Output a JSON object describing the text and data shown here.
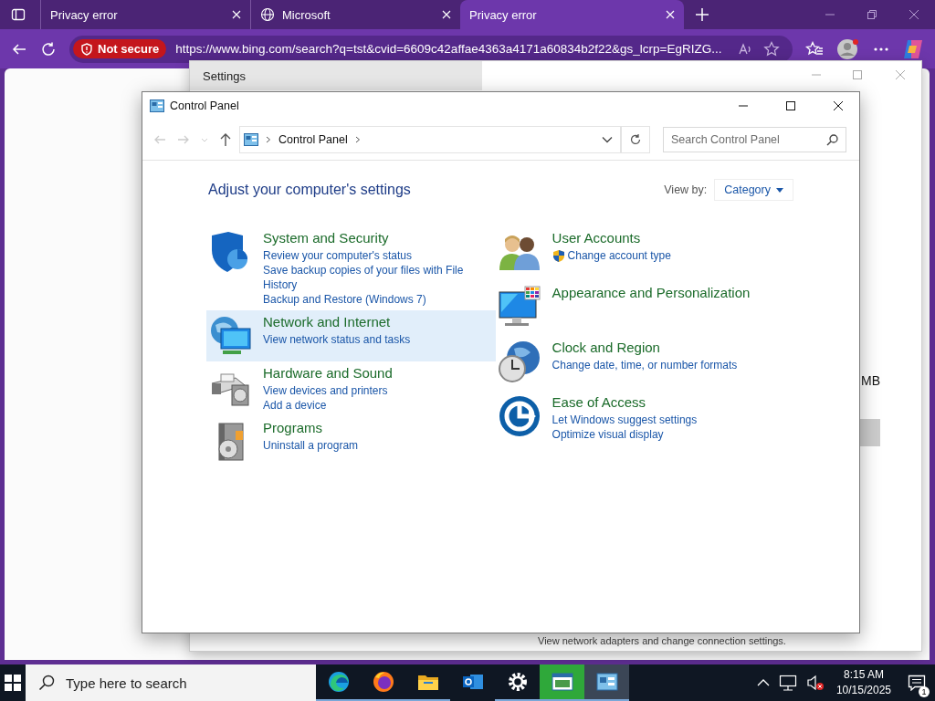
{
  "browser": {
    "tabs": [
      {
        "title": "Privacy error",
        "kind": "plain",
        "selected": false
      },
      {
        "title": "Microsoft",
        "kind": "globe",
        "selected": false
      },
      {
        "title": "Privacy error",
        "kind": "plain",
        "selected": true
      }
    ],
    "security_label": "Not secure",
    "url": "https://www.bing.com/search?q=tst&cvid=6609c42affae4363a4171a60834b2f22&gs_lcrp=EgRIZG..."
  },
  "settings_window": {
    "title": "Settings",
    "size_text": "MB",
    "footer_text": "View network adapters and change connection settings."
  },
  "control_panel": {
    "title": "Control Panel",
    "breadcrumb": "Control Panel",
    "search_placeholder": "Search Control Panel",
    "heading": "Adjust your computer's settings",
    "view_by_label": "View by:",
    "view_by_value": "Category",
    "columns": [
      [
        {
          "kind": "shield",
          "title": "System and Security",
          "hovered": false,
          "links": [
            {
              "text": "Review your computer's status",
              "shield": false
            },
            {
              "text": "Save backup copies of your files with File History",
              "shield": false
            },
            {
              "text": "Backup and Restore (Windows 7)",
              "shield": false
            }
          ]
        },
        {
          "kind": "network",
          "title": "Network and Internet",
          "hovered": true,
          "links": [
            {
              "text": "View network status and tasks",
              "shield": false
            }
          ]
        },
        {
          "kind": "hardware",
          "title": "Hardware and Sound",
          "hovered": false,
          "links": [
            {
              "text": "View devices and printers",
              "shield": false
            },
            {
              "text": "Add a device",
              "shield": false
            }
          ]
        },
        {
          "kind": "programs",
          "title": "Programs",
          "hovered": false,
          "links": [
            {
              "text": "Uninstall a program",
              "shield": false
            }
          ]
        }
      ],
      [
        {
          "kind": "users",
          "title": "User Accounts",
          "hovered": false,
          "links": [
            {
              "text": "Change account type",
              "shield": true
            }
          ]
        },
        {
          "kind": "appearance",
          "title": "Appearance and Personalization",
          "hovered": false
        },
        {
          "kind": "clock",
          "title": "Clock and Region",
          "hovered": false,
          "links": [
            {
              "text": "Change date, time, or number formats",
              "shield": false
            }
          ]
        },
        {
          "kind": "access",
          "title": "Ease of Access",
          "hovered": false,
          "links": [
            {
              "text": "Let Windows suggest settings",
              "shield": false
            },
            {
              "text": "Optimize visual display",
              "shield": false
            }
          ]
        }
      ]
    ]
  },
  "taskbar": {
    "search_placeholder": "Type here to search",
    "apps": [
      {
        "kind": "edge",
        "running": true,
        "active": false,
        "attention": false
      },
      {
        "kind": "firefox",
        "running": true,
        "active": false,
        "attention": false
      },
      {
        "kind": "folder",
        "running": true,
        "active": false,
        "attention": false
      },
      {
        "kind": "outlook",
        "running": false,
        "active": false,
        "attention": false
      },
      {
        "kind": "gear",
        "running": true,
        "active": false,
        "attention": false
      },
      {
        "kind": "app-window",
        "running": true,
        "active": false,
        "attention": true
      },
      {
        "kind": "control-panel",
        "running": true,
        "active": true,
        "attention": false
      }
    ],
    "time": "8:15 AM",
    "date": "10/15/2025",
    "notification_count": "1"
  }
}
